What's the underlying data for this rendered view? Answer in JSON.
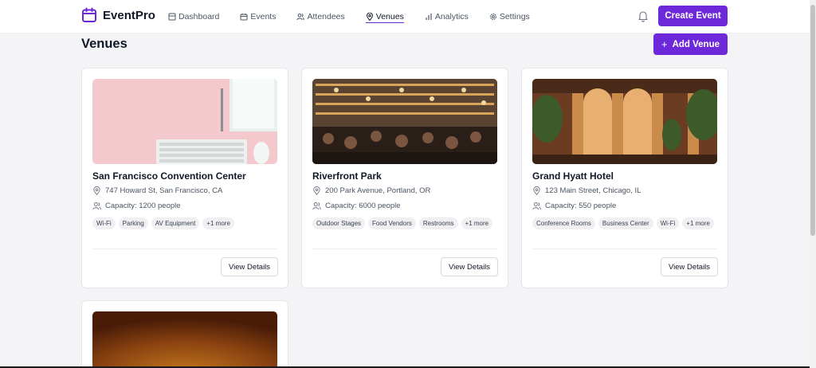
{
  "brand": {
    "name": "EventPro",
    "accent": "#6d28d9"
  },
  "nav": [
    {
      "label": "Dashboard",
      "icon": "layout-icon",
      "active": false
    },
    {
      "label": "Events",
      "icon": "calendar-icon",
      "active": false
    },
    {
      "label": "Attendees",
      "icon": "users-icon",
      "active": false
    },
    {
      "label": "Venues",
      "icon": "map-pin-icon",
      "active": true
    },
    {
      "label": "Analytics",
      "icon": "bar-chart-icon",
      "active": false
    },
    {
      "label": "Settings",
      "icon": "gear-icon",
      "active": false
    }
  ],
  "header": {
    "create_label": "Create Event",
    "bell_icon": "bell-icon"
  },
  "page": {
    "title": "Venues",
    "add_label": "Add Venue"
  },
  "venues": [
    {
      "name": "San Francisco Convention Center",
      "address": "747 Howard St, San Francisco, CA",
      "capacity": "Capacity: 1200 people",
      "tags": [
        "Wi-Fi",
        "Parking",
        "AV Equipment",
        "+1 more"
      ],
      "button": "View Details"
    },
    {
      "name": "Riverfront Park",
      "address": "200 Park Avenue, Portland, OR",
      "capacity": "Capacity: 6000 people",
      "tags": [
        "Outdoor Stages",
        "Food Vendors",
        "Restrooms",
        "+1 more"
      ],
      "button": "View Details"
    },
    {
      "name": "Grand Hyatt Hotel",
      "address": "123 Main Street, Chicago, IL",
      "capacity": "Capacity: 550 people",
      "tags": [
        "Conference Rooms",
        "Business Center",
        "Wi-Fi",
        "+1 more"
      ],
      "button": "View Details"
    }
  ]
}
